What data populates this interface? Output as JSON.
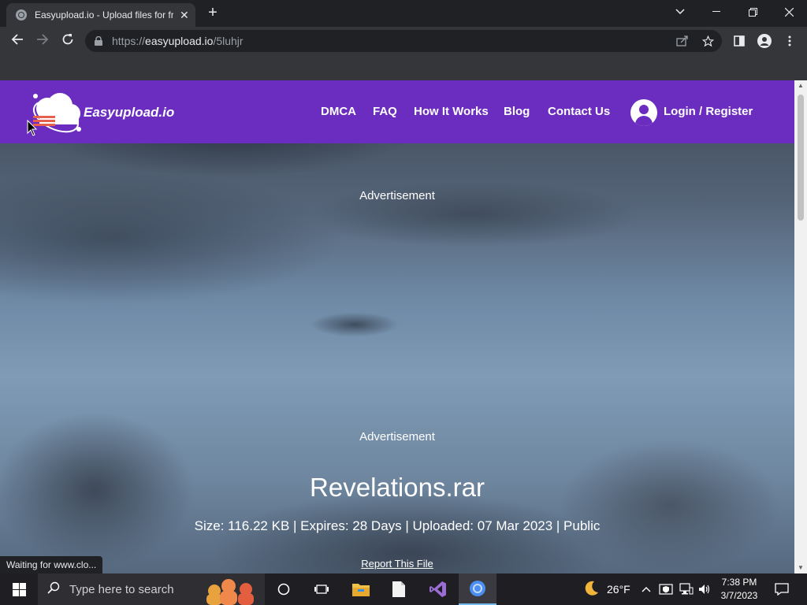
{
  "browser": {
    "tab_title": "Easyupload.io - Upload files for free",
    "url_prefix": "https://",
    "url_host": "easyupload.io",
    "url_path": "/5luhjr",
    "status_text": "Waiting for www.clo..."
  },
  "site": {
    "logo_text": "Easyupload.io",
    "nav": [
      "DMCA",
      "FAQ",
      "How It Works",
      "Blog",
      "Contact Us"
    ],
    "login_label": "Login / Register",
    "ad_label_1": "Advertisement",
    "ad_label_2": "Advertisement",
    "file_name": "Revelations.rar",
    "file_meta": "Size: 116.22 KB | Expires: 28 Days | Uploaded: 07 Mar 2023 | Public",
    "report_label": "Report This File",
    "brand_color": "#6a2dc0"
  },
  "taskbar": {
    "search_placeholder": "Type here to search",
    "weather_temp": "26°F",
    "time": "7:38 PM",
    "date": "3/7/2023"
  }
}
